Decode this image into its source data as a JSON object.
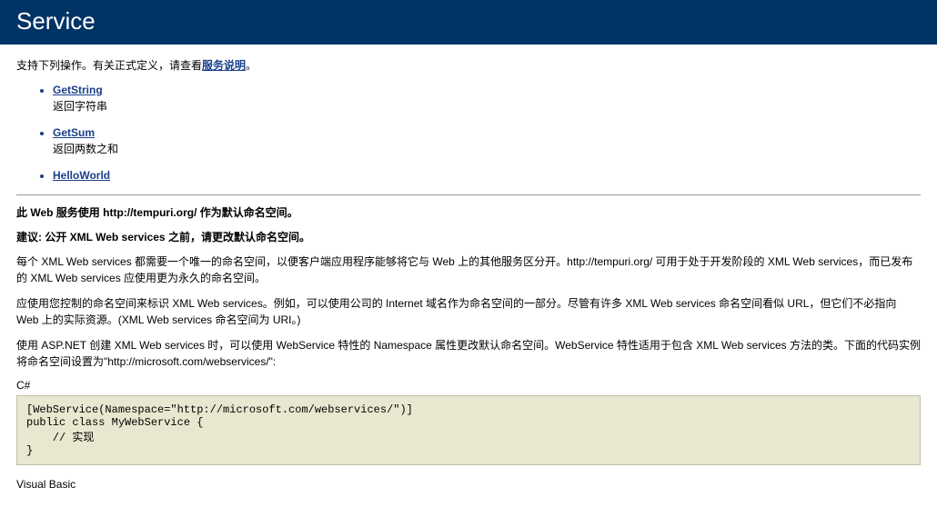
{
  "header": {
    "title": "Service"
  },
  "intro": {
    "prefix": "支持下列操作。有关正式定义，请查看",
    "link": "服务说明",
    "suffix": "。"
  },
  "operations": [
    {
      "name": "GetString",
      "desc": "返回字符串"
    },
    {
      "name": "GetSum",
      "desc": "返回两数之和"
    },
    {
      "name": "HelloWorld",
      "desc": ""
    }
  ],
  "notice": {
    "line1": "此 Web 服务使用 http://tempuri.org/ 作为默认命名空间。",
    "line2": "建议: 公开 XML Web services 之前，请更改默认命名空间。"
  },
  "paragraphs": {
    "p1": "每个 XML Web services 都需要一个唯一的命名空间，以便客户端应用程序能够将它与 Web 上的其他服务区分开。http://tempuri.org/ 可用于处于开发阶段的 XML Web services，而已发布的 XML Web services 应使用更为永久的命名空间。",
    "p2": "应使用您控制的命名空间来标识 XML Web services。例如，可以使用公司的 Internet 域名作为命名空间的一部分。尽管有许多 XML Web services 命名空间看似 URL，但它们不必指向 Web 上的实际资源。(XML Web services 命名空间为 URI。)",
    "p3": "使用 ASP.NET 创建 XML Web services 时，可以使用 WebService 特性的 Namespace 属性更改默认命名空间。WebService 特性适用于包含 XML Web services 方法的类。下面的代码实例将命名空间设置为\"http://microsoft.com/webservices/\":"
  },
  "code": {
    "csharp_label": "C#",
    "csharp": "[WebService(Namespace=\"http://microsoft.com/webservices/\")]\npublic class MyWebService {\n    // 实现\n}",
    "vb_label": "Visual Basic"
  }
}
